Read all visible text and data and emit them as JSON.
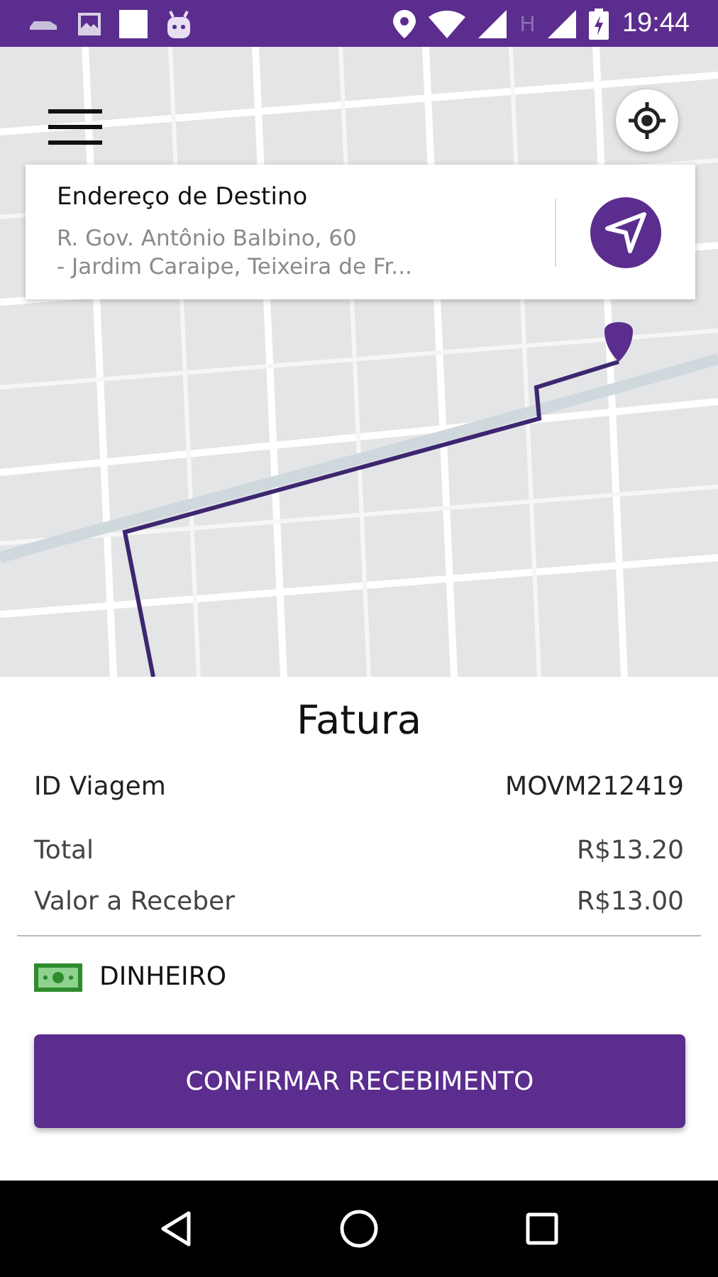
{
  "status_bar": {
    "network_type": "H",
    "time": "19:44"
  },
  "destination": {
    "label": "Endereço de Destino",
    "address_lines": [
      "R. Gov. Antônio Balbino, 60",
      "- Jardim Caraipe, Teixeira de Fr..."
    ]
  },
  "invoice": {
    "title": "Fatura",
    "rows": [
      {
        "label": "ID Viagem",
        "value": "MOVM212419",
        "kind": "id"
      },
      {
        "label": "Total",
        "value": "R$13.20",
        "kind": "amount"
      },
      {
        "label": "Valor a Receber",
        "value": "R$13.00",
        "kind": "amount"
      }
    ],
    "payment_method": "DINHEIRO",
    "confirm_button": "CONFIRMAR RECEBIMENTO"
  }
}
